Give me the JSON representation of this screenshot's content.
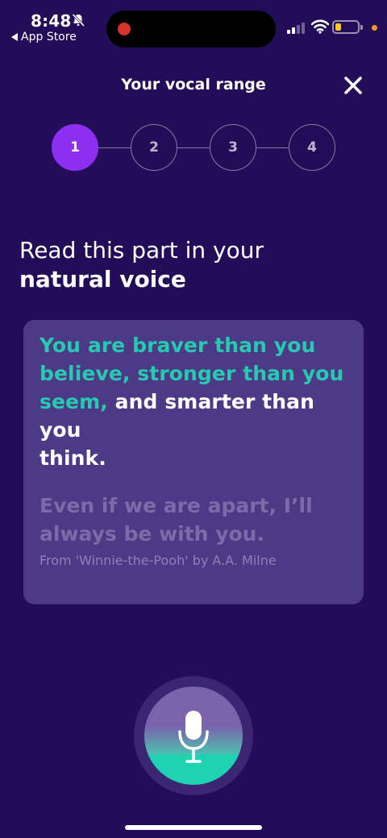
{
  "status_bar": {
    "time": "8:48",
    "back_label": "App Store",
    "silent_icon": "bell-slash-icon",
    "battery_color": "#f7c928",
    "recording_color": "#d8332a"
  },
  "header": {
    "title": "Your vocal range",
    "close_icon": "close-icon"
  },
  "stepper": {
    "current": 1,
    "steps": [
      "1",
      "2",
      "3",
      "4"
    ],
    "active_color": "#8d2ff0"
  },
  "prompt": {
    "line1": "Read this part in your",
    "line2": "natural voice"
  },
  "quote": {
    "highlighted_line1": "You are braver than you",
    "highlighted_line2": "believe, stronger than you",
    "highlighted_line3": "seem,",
    "rest_line3": " and smarter than you",
    "rest_line4": "think.",
    "next_line1": "Even if we are apart, I’ll",
    "next_line2": "always be with you.",
    "attribution": "From 'Winnie-the-Pooh' by A.A. Milne",
    "highlight_color": "#27c9b0"
  },
  "mic": {
    "icon": "microphone-icon",
    "level": 0.32,
    "color": "#1fd2b2"
  }
}
